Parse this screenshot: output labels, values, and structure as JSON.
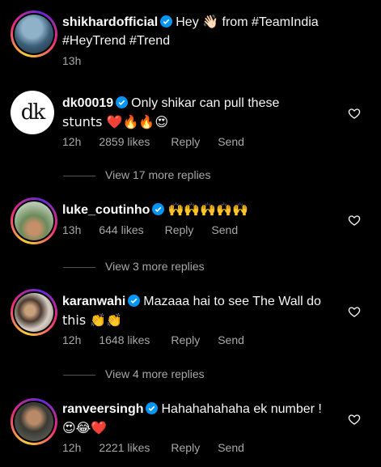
{
  "caption": {
    "username": "shikhardofficial",
    "text1": "Hey 👋🏻 from #TeamIndia",
    "text2": "#HeyTrend #Trend",
    "time": "13h"
  },
  "comments": [
    {
      "username": "dk00019",
      "text1": "Only shikar can pull these",
      "text2": "stunts ❤️🔥🔥😍",
      "time": "12h",
      "likes": "2859 likes",
      "reply": "Reply",
      "send": "Send",
      "view_more": "View 17 more replies"
    },
    {
      "username": "luke_coutinho",
      "text1": "🙌🙌🙌🙌🙌",
      "time": "13h",
      "likes": "644 likes",
      "reply": "Reply",
      "send": "Send",
      "view_more": "View 3 more replies"
    },
    {
      "username": "karanwahi",
      "text1": "Mazaaa hai to see The Wall do",
      "text2": "this 👏👏",
      "time": "12h",
      "likes": "1648 likes",
      "reply": "Reply",
      "send": "Send",
      "view_more": "View 4 more replies"
    },
    {
      "username": "ranveersingh",
      "text1": "Hahahahahaha ek number !",
      "text2": "😍😂❤️",
      "time": "12h",
      "likes": "2221 likes",
      "reply": "Reply",
      "send": "Send"
    }
  ],
  "icons": {
    "verified": "verified-badge-icon",
    "like": "heart-outline-icon"
  },
  "colors": {
    "background": "#000000",
    "verified": "#0095f6",
    "meta": "#a8a8a8"
  }
}
